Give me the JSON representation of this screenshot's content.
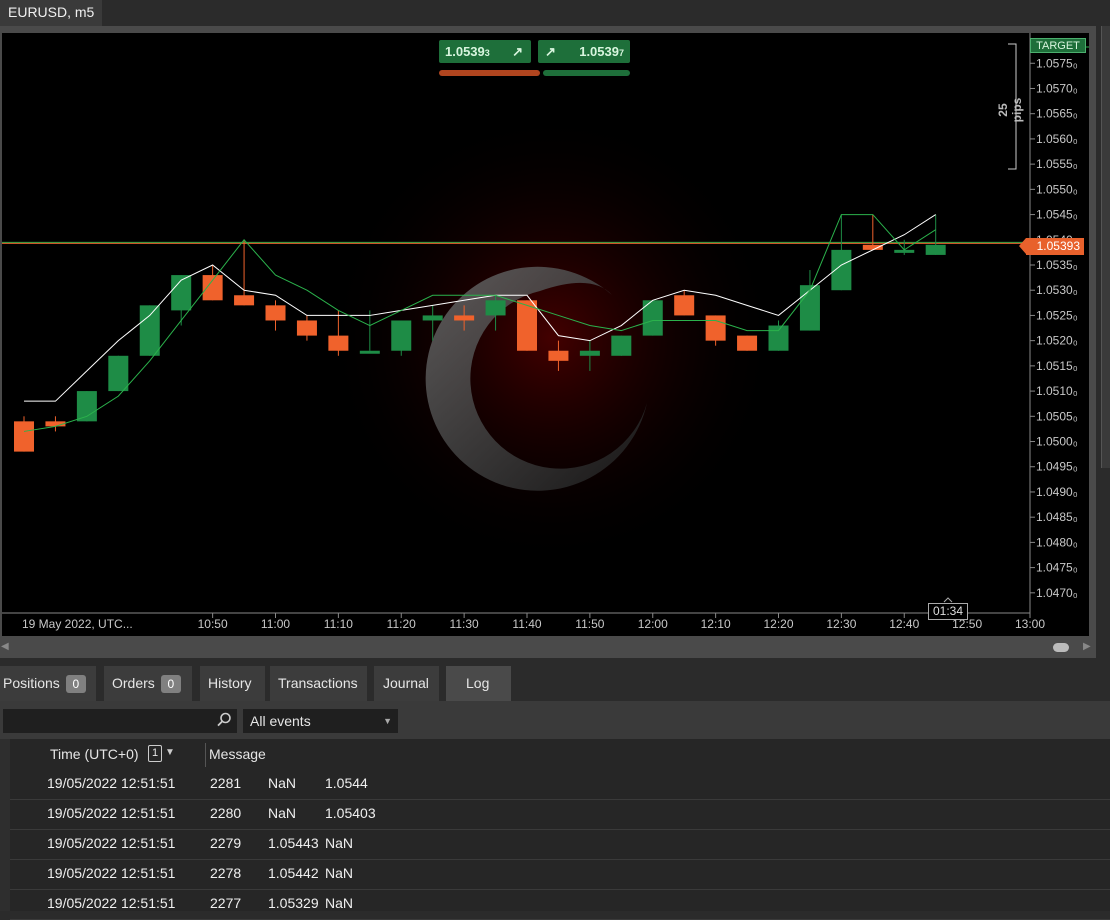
{
  "window": {
    "chart_tab": "EURUSD, m5"
  },
  "quote": {
    "sell_main": "1.0539",
    "sell_pip": "3",
    "sell_arrow": "↗",
    "buy_arrow": "↗",
    "buy_main": "1.0539",
    "buy_pip": "7"
  },
  "chart_overlay": {
    "target_label": "TARGET",
    "pips_label": "25 pips",
    "current_price": "1.05393",
    "countdown": "01:34"
  },
  "colors": {
    "bull": "#1e8c46",
    "bear": "#f0622c",
    "ma_white": "#ffffff",
    "ma_green": "#2bb24c",
    "accent": "#e8612c",
    "brand_green": "#1e6f3a"
  },
  "chart_data": {
    "type": "candlestick",
    "symbol": "EURUSD",
    "timeframe": "m5",
    "ylim": [
      1.0466,
      1.0581
    ],
    "y_ticks": [
      1.0575,
      1.057,
      1.0565,
      1.056,
      1.0555,
      1.055,
      1.0545,
      1.054,
      1.0535,
      1.053,
      1.0525,
      1.052,
      1.0515,
      1.051,
      1.0505,
      1.05,
      1.0495,
      1.049,
      1.0485,
      1.048,
      1.0475,
      1.047
    ],
    "y_tick_labels": [
      "1.0575₀",
      "1.0570₀",
      "1.0565₀",
      "1.0560₀",
      "1.0555₀",
      "1.0550₀",
      "1.0545₀",
      "1.0540₀",
      "1.0535₀",
      "1.0530₀",
      "1.0525₀",
      "1.0520₀",
      "1.0515₀",
      "1.0510₀",
      "1.0505₀",
      "1.0500₀",
      "1.0495₀",
      "1.0490₀",
      "1.0485₀",
      "1.0480₀",
      "1.0475₀",
      "1.0470₀"
    ],
    "x_tick_labels": [
      "19 May 2022, UTC...",
      "10:50",
      "11:00",
      "11:10",
      "11:20",
      "11:30",
      "11:40",
      "11:50",
      "12:00",
      "12:10",
      "12:20",
      "12:30",
      "12:40",
      "12:50",
      "13:00"
    ],
    "x_tick_minutes": [
      null,
      50,
      60,
      70,
      80,
      90,
      100,
      110,
      120,
      130,
      140,
      150,
      160,
      170,
      180
    ],
    "x_minute_range": [
      16.5,
      180
    ],
    "current_price_line": 1.05393,
    "candles": [
      {
        "t": "10:20",
        "o": 1.0504,
        "h": 1.0505,
        "l": 1.0498,
        "c": 1.0498
      },
      {
        "t": "10:25",
        "o": 1.0504,
        "h": 1.0505,
        "l": 1.0502,
        "c": 1.0503
      },
      {
        "t": "10:30",
        "o": 1.0504,
        "h": 1.051,
        "l": 1.0504,
        "c": 1.051
      },
      {
        "t": "10:35",
        "o": 1.051,
        "h": 1.0517,
        "l": 1.051,
        "c": 1.0517
      },
      {
        "t": "10:40",
        "o": 1.0517,
        "h": 1.0527,
        "l": 1.0517,
        "c": 1.0527
      },
      {
        "t": "10:45",
        "o": 1.0526,
        "h": 1.0533,
        "l": 1.0523,
        "c": 1.0533
      },
      {
        "t": "10:50",
        "o": 1.0533,
        "h": 1.0535,
        "l": 1.0528,
        "c": 1.0528
      },
      {
        "t": "10:55",
        "o": 1.0529,
        "h": 1.054,
        "l": 1.0527,
        "c": 1.0527
      },
      {
        "t": "11:00",
        "o": 1.0527,
        "h": 1.0528,
        "l": 1.0522,
        "c": 1.0524
      },
      {
        "t": "11:05",
        "o": 1.0524,
        "h": 1.0525,
        "l": 1.052,
        "c": 1.0521
      },
      {
        "t": "11:10",
        "o": 1.0521,
        "h": 1.0526,
        "l": 1.0517,
        "c": 1.0518
      },
      {
        "t": "11:15",
        "o": 1.0518,
        "h": 1.0526,
        "l": 1.0518,
        "c": 1.0518
      },
      {
        "t": "11:20",
        "o": 1.0518,
        "h": 1.0524,
        "l": 1.0517,
        "c": 1.0524
      },
      {
        "t": "11:25",
        "o": 1.0524,
        "h": 1.0527,
        "l": 1.052,
        "c": 1.0525
      },
      {
        "t": "11:30",
        "o": 1.0525,
        "h": 1.0527,
        "l": 1.0522,
        "c": 1.0524
      },
      {
        "t": "11:35",
        "o": 1.0525,
        "h": 1.0529,
        "l": 1.0522,
        "c": 1.0528
      },
      {
        "t": "11:40",
        "o": 1.0528,
        "h": 1.0528,
        "l": 1.0518,
        "c": 1.0518
      },
      {
        "t": "11:45",
        "o": 1.0518,
        "h": 1.052,
        "l": 1.0514,
        "c": 1.0516
      },
      {
        "t": "11:50",
        "o": 1.0517,
        "h": 1.052,
        "l": 1.0514,
        "c": 1.0518
      },
      {
        "t": "11:55",
        "o": 1.0517,
        "h": 1.0521,
        "l": 1.0517,
        "c": 1.0521
      },
      {
        "t": "12:00",
        "o": 1.0521,
        "h": 1.0528,
        "l": 1.0521,
        "c": 1.0528
      },
      {
        "t": "12:05",
        "o": 1.0529,
        "h": 1.053,
        "l": 1.0525,
        "c": 1.0525
      },
      {
        "t": "12:10",
        "o": 1.0525,
        "h": 1.0525,
        "l": 1.0519,
        "c": 1.052
      },
      {
        "t": "12:15",
        "o": 1.0521,
        "h": 1.0521,
        "l": 1.0518,
        "c": 1.0518
      },
      {
        "t": "12:20",
        "o": 1.0518,
        "h": 1.0524,
        "l": 1.0518,
        "c": 1.0523
      },
      {
        "t": "12:25",
        "o": 1.0522,
        "h": 1.0534,
        "l": 1.0522,
        "c": 1.0531
      },
      {
        "t": "12:30",
        "o": 1.053,
        "h": 1.0545,
        "l": 1.053,
        "c": 1.0538
      },
      {
        "t": "12:35",
        "o": 1.0539,
        "h": 1.0545,
        "l": 1.0538,
        "c": 1.0538
      },
      {
        "t": "12:40",
        "o": 1.0538,
        "h": 1.054,
        "l": 1.0537,
        "c": 1.0538
      },
      {
        "t": "12:45",
        "o": 1.0537,
        "h": 1.0545,
        "l": 1.0537,
        "c": 1.0539
      }
    ],
    "series": [
      {
        "color": "#ffffff",
        "values": [
          1.0508,
          1.0508,
          1.0514,
          1.052,
          1.0525,
          1.0532,
          1.0535,
          1.053,
          1.0529,
          1.0525,
          1.0525,
          1.0525,
          1.0526,
          1.0527,
          1.0528,
          1.0529,
          1.0529,
          1.0521,
          1.052,
          1.0523,
          1.0528,
          1.053,
          1.0529,
          1.0527,
          1.0525,
          1.053,
          1.0535,
          1.0538,
          1.0541,
          1.0545
        ]
      },
      {
        "color": "#2bb24c",
        "values": [
          1.0502,
          1.0503,
          1.0505,
          1.0509,
          1.0516,
          1.0524,
          1.0532,
          1.054,
          1.0533,
          1.053,
          1.0526,
          1.0523,
          1.0526,
          1.0529,
          1.0529,
          1.0529,
          1.0527,
          1.0525,
          1.0523,
          1.0522,
          1.0524,
          1.0524,
          1.0524,
          1.0522,
          1.0522,
          1.053,
          1.0545,
          1.0545,
          1.0538,
          1.0542
        ]
      }
    ]
  },
  "bottom_tabs": [
    {
      "label": "Positions",
      "badge": "0"
    },
    {
      "label": "Orders",
      "badge": "0"
    },
    {
      "label": "History"
    },
    {
      "label": "Transactions"
    },
    {
      "label": "Journal"
    },
    {
      "label": "Log"
    }
  ],
  "filter": {
    "search_value": "",
    "events_selected": "All events"
  },
  "log": {
    "col_time": "Time (UTC+0)",
    "sort_index": "1",
    "col_message": "Message",
    "rows": [
      {
        "time": "19/05/2022 12:51:51",
        "id": "2281",
        "v1": "NaN",
        "v2": "1.0544"
      },
      {
        "time": "19/05/2022 12:51:51",
        "id": "2280",
        "v1": "NaN",
        "v2": "1.05403"
      },
      {
        "time": "19/05/2022 12:51:51",
        "id": "2279",
        "v1": "1.05443",
        "v2": "NaN"
      },
      {
        "time": "19/05/2022 12:51:51",
        "id": "2278",
        "v1": "1.05442",
        "v2": "NaN"
      },
      {
        "time": "19/05/2022 12:51:51",
        "id": "2277",
        "v1": "1.05329",
        "v2": "NaN"
      }
    ]
  }
}
